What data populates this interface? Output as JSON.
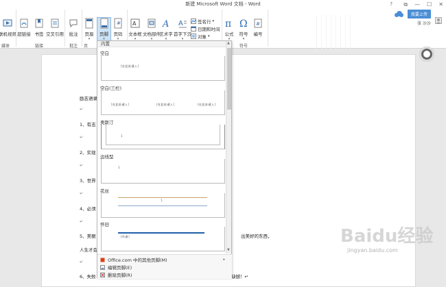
{
  "window": {
    "title": "新建 Microsoft Word 文档 - Word"
  },
  "account": {
    "share_label": "我要上传",
    "user_name": "张 沙沙"
  },
  "ribbon": {
    "buttons": [
      {
        "label": "联机视频",
        "icon": "video-icon"
      },
      {
        "label": "超链接",
        "icon": "hyperlink-icon"
      },
      {
        "label": "书签",
        "icon": "bookmark-icon"
      },
      {
        "label": "交叉引用",
        "icon": "cross-reference-icon"
      },
      {
        "label": "批注",
        "icon": "comment-icon"
      },
      {
        "label": "页眉",
        "icon": "header-icon"
      },
      {
        "label": "页脚",
        "icon": "footer-icon"
      },
      {
        "label": "页码",
        "icon": "page-number-icon"
      },
      {
        "label": "文本框",
        "icon": "textbox-icon"
      },
      {
        "label": "文档部件",
        "icon": "quick-parts-icon"
      },
      {
        "label": "艺术字",
        "icon": "wordart-icon"
      },
      {
        "label": "首字下沉",
        "icon": "drop-cap-icon"
      },
      {
        "label": "公式",
        "icon": "equation-icon"
      },
      {
        "label": "符号",
        "icon": "symbol-icon"
      },
      {
        "label": "编号",
        "icon": "number-icon"
      }
    ],
    "small_buttons": [
      {
        "label": "签名行",
        "icon": "signature-icon"
      },
      {
        "label": "日期和时间",
        "icon": "datetime-icon"
      },
      {
        "label": "对象",
        "icon": "object-icon"
      }
    ],
    "groups": [
      "媒体",
      "链接",
      "批注",
      "页",
      "符号"
    ]
  },
  "footer_gallery": {
    "header": "内置",
    "items": [
      {
        "label": "空白",
        "placeholders": [
          "[在此处键入]"
        ]
      },
      {
        "label": "空白(三栏)",
        "placeholders": [
          "[在此处键入]",
          "[在此处键入]",
          "[在此处键入]"
        ]
      },
      {
        "label": "奥斯汀",
        "placeholders": [
          "1"
        ]
      },
      {
        "label": "边线型",
        "placeholders": [
          "1"
        ]
      },
      {
        "label": "花丝",
        "placeholders": [
          "1"
        ]
      },
      {
        "label": "怀旧",
        "placeholders": [
          "[作者]"
        ]
      }
    ],
    "menu": [
      {
        "label": "Office.com 中的其他页脚(M)",
        "icon": "office-icon"
      },
      {
        "label": "编辑页脚(E)",
        "icon": "edit-footer-icon"
      },
      {
        "label": "删除页脚(R)",
        "icon": "remove-footer-icon"
      }
    ]
  },
  "document": {
    "lines": [
      {
        "text": "励志语录"
      },
      {
        "text": "↵"
      },
      {
        "text": "1、有志"
      },
      {
        "text": "↵"
      },
      {
        "text": "2、实现"
      },
      {
        "text": "↵"
      },
      {
        "text": "3、世界"
      },
      {
        "text": "↵"
      },
      {
        "text": "4、必须"
      },
      {
        "text": "↵"
      },
      {
        "text": "5、美丽"
      },
      {
        "text": "人生才会"
      },
      {
        "text": "↵"
      },
      {
        "text": "6、失败"
      }
    ],
    "right_fragments": [
      {
        "text": "出美好的东西，"
      },
      {
        "text": "缺憾！↵"
      }
    ]
  },
  "watermark": {
    "text": "Baidu经验",
    "url_text": "jingyan.baidu.com"
  }
}
